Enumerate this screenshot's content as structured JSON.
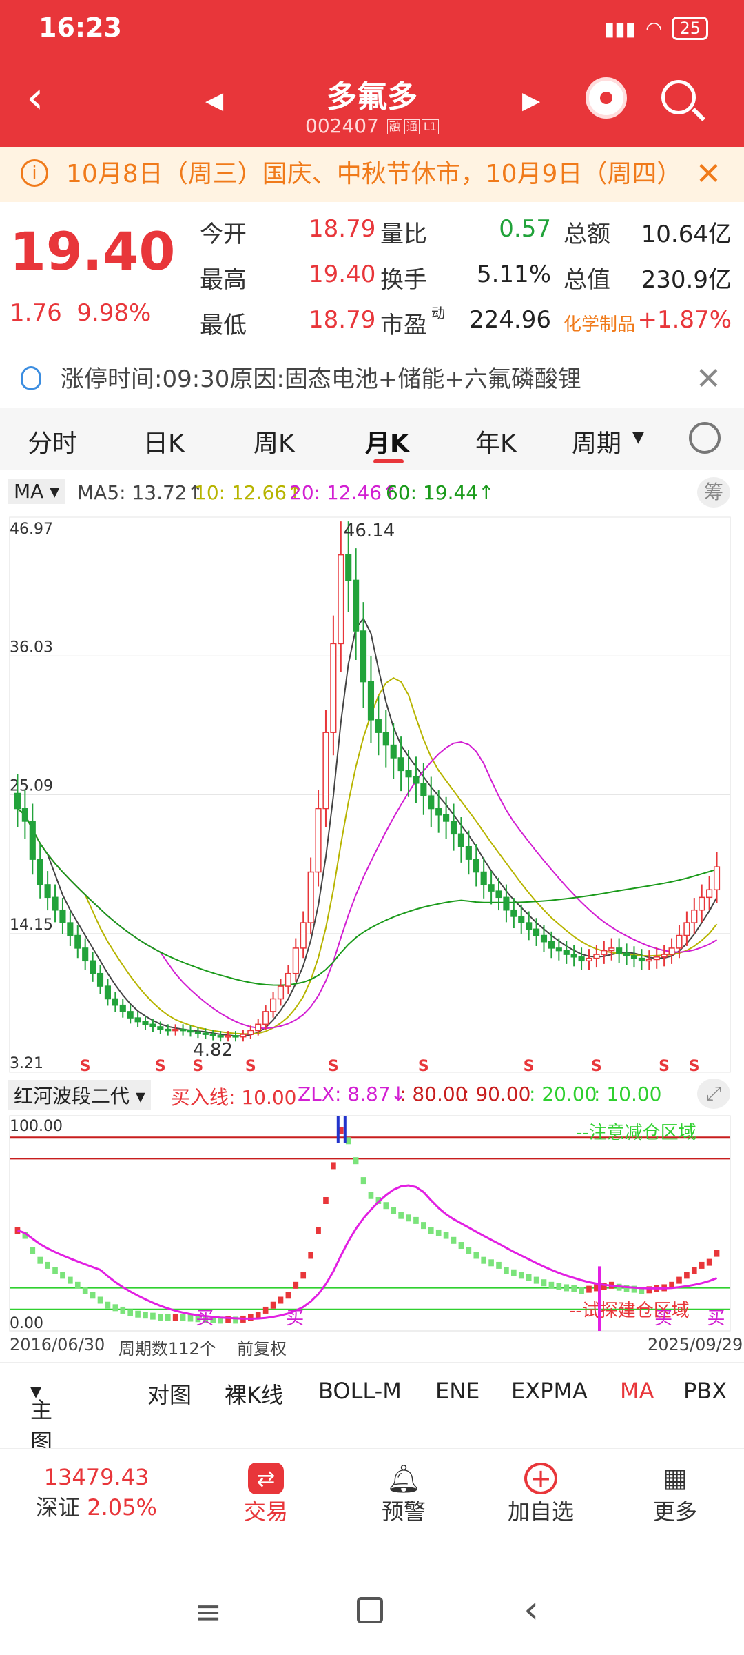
{
  "status": {
    "time": "16:23",
    "battery": "25"
  },
  "header": {
    "title": "多氟多",
    "code": "002407",
    "tag1": "融",
    "tag2": "通",
    "tag3": "L1"
  },
  "notice": {
    "text": "10月8日（周三）国庆、中秋节休市，10月9日（周四）"
  },
  "quote": {
    "price": "19.40",
    "change": "1.76",
    "change_pct": "9.98%",
    "rows": [
      {
        "l1": "今开",
        "v1": "18.79",
        "l2": "量比",
        "v2": "0.57",
        "l3": "总额",
        "v3": "10.64亿"
      },
      {
        "l1": "最高",
        "v1": "19.40",
        "l2": "换手",
        "v2": "5.11%",
        "l3": "总值",
        "v3": "230.9亿"
      },
      {
        "l1": "最低",
        "v1": "18.79",
        "l2": "市盈",
        "v2": "224.96",
        "l3": "化学制品",
        "v3": "+1.87%"
      }
    ],
    "pe_sup": "动"
  },
  "limit_up": {
    "text": "涨停时间:09:30原因:固态电池+储能+六氟磷酸锂"
  },
  "tabs": [
    "分时",
    "日K",
    "周K",
    "月K",
    "年K",
    "周期"
  ],
  "active_tab": "月K",
  "ma_legend": {
    "label": "MA",
    "ma5": "MA5: 13.72↑",
    "ma10": "10: 12.66↑",
    "ma20": "20: 12.46↑",
    "ma60": "60: 19.44↑",
    "chip": "筹"
  },
  "indicator_legend": {
    "name": "红河波段二代",
    "buy": "买入线: 10.00",
    "zlx": "ZLX: 8.87↓",
    "v80": ": 80.00",
    "v90": ": 90.00",
    "v20": ": 20.00",
    "v10": ": 10.00"
  },
  "axis": {
    "start": "2016/06/30",
    "periods": "周期数112个",
    "adj": "前复权",
    "end": "2025/09/29"
  },
  "indicator_tabs": [
    "主图",
    "对图",
    "裸K线",
    "BOLL-M",
    "ENE",
    "EXPMA",
    "MA",
    "PBX"
  ],
  "bottom": {
    "index_value": "13479.43",
    "index_name": "深证",
    "index_pct": "2.05%",
    "trade": "交易",
    "alert": "预警",
    "add": "加自选",
    "more": "更多"
  },
  "chart_data": {
    "type": "candlestick",
    "yticks": [
      "46.97",
      "36.03",
      "25.09",
      "14.15",
      "3.21"
    ],
    "ylim": [
      3.21,
      46.97
    ],
    "max_label": "46.14",
    "min_label": "4.82",
    "sell_marker": "S",
    "indicator": {
      "ylim": [
        0,
        100
      ],
      "ytop": "100.00",
      "ybottom": "0.00",
      "top_zone": "--注意减仓区域",
      "bottom_zone": "--试探建仓区域",
      "buy_marker": "买"
    },
    "closes": [
      24,
      23,
      20,
      18,
      17,
      16,
      15,
      14,
      13,
      12,
      11,
      10,
      9,
      8.5,
      8,
      7.5,
      7.2,
      7,
      6.8,
      6.6,
      6.5,
      6.6,
      6.5,
      6.4,
      6.3,
      6.2,
      6.1,
      6.0,
      6.1,
      6.0,
      6.2,
      6.5,
      7,
      8,
      9,
      10,
      11,
      13,
      15,
      19,
      24,
      30,
      37,
      44,
      42,
      38,
      34,
      31,
      30,
      29,
      28,
      27,
      26.5,
      26,
      25,
      24,
      23.5,
      23,
      22,
      21,
      20,
      19,
      18,
      17.5,
      17,
      16,
      15.5,
      15,
      14.5,
      14,
      13.5,
      13,
      12.8,
      12.5,
      12.3,
      12,
      12.2,
      12.5,
      12.8,
      13,
      12.6,
      12.4,
      12.2,
      12,
      12.1,
      12.3,
      12.5,
      13,
      14,
      15,
      16,
      17,
      17.6,
      19.4
    ]
  }
}
